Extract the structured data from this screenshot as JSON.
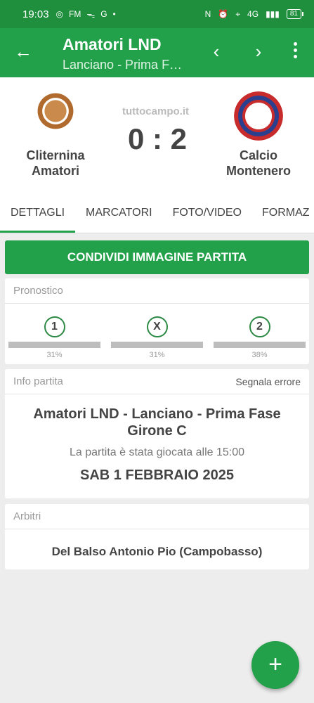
{
  "status_bar": {
    "time": "19:03",
    "left_icons": [
      "◎",
      "FM",
      "ᯓ",
      "G",
      "•"
    ],
    "right_icons": [
      "N",
      "⏰",
      "⌖",
      "4G",
      "▮▮▮"
    ],
    "battery": "81"
  },
  "app_bar": {
    "title": "Amatori LND",
    "subtitle": "Lanciano - Prima F…",
    "back_icon": "←",
    "prev_icon": "‹",
    "next_icon": "›"
  },
  "match": {
    "brand": "tuttocampo.it",
    "score": "0 : 2",
    "home": {
      "name": "Cliternina Amatori"
    },
    "away": {
      "name": "Calcio Montenero"
    }
  },
  "tabs": [
    "DETTAGLI",
    "MARCATORI",
    "FOTO/VIDEO",
    "FORMAZ"
  ],
  "share_button": "CONDIVIDI IMMAGINE PARTITA",
  "pronostico": {
    "label": "Pronostico",
    "options": [
      {
        "symbol": "1",
        "percent": "31%"
      },
      {
        "symbol": "X",
        "percent": "31%"
      },
      {
        "symbol": "2",
        "percent": "38%"
      }
    ]
  },
  "info": {
    "label": "Info partita",
    "action": "Segnala errore",
    "competition": "Amatori LND - Lanciano - Prima Fase Girone C",
    "note": "La partita è stata giocata alle 15:00",
    "date": "SAB 1 FEBBRAIO 2025"
  },
  "arbitri": {
    "label": "Arbitri",
    "name": "Del Balso Antonio Pio (Campobasso)"
  },
  "fab": "+",
  "colors": {
    "primary": "#22a04a",
    "status_bar": "#1f8f3e"
  }
}
